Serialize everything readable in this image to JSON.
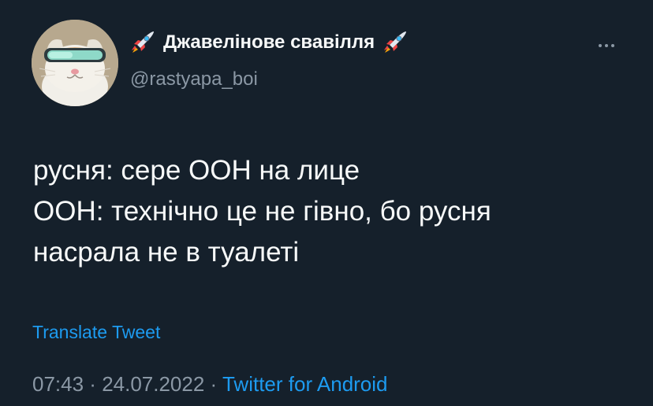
{
  "author": {
    "display_name": "Джавелінове свавілля",
    "handle": "@rastyapa_boi",
    "name_emoji_left": "rocket-icon",
    "name_emoji_right": "rocket-icon"
  },
  "tweet": {
    "lines": [
      "русня: сере ООН на лице",
      "ООН: технічно це не гівно, бо русня",
      "насрала не в туалеті"
    ],
    "translate_label": "Translate Tweet"
  },
  "meta": {
    "time": "07:43",
    "separator": " · ",
    "date": "24.07.2022",
    "source": "Twitter for Android"
  },
  "colors": {
    "background": "#15202b",
    "text": "#f7f9f9",
    "secondary": "#8b98a5",
    "accent": "#1d9bf0"
  }
}
